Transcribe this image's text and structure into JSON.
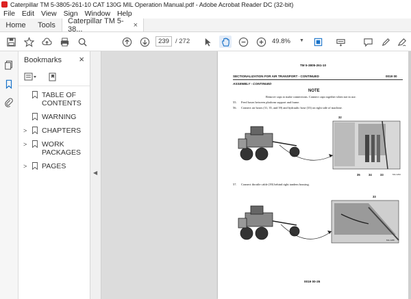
{
  "window": {
    "title": "Caterpillar TM 5-3805-261-10 CAT 130G MIL Operation Manual.pdf - Adobe Acrobat Reader DC (32-bit)"
  },
  "menu": {
    "items": [
      "File",
      "Edit",
      "View",
      "Sign",
      "Window",
      "Help"
    ]
  },
  "tabs": {
    "home": "Home",
    "tools": "Tools",
    "document": "Caterpillar TM 5-38...",
    "close": "×"
  },
  "toolbar": {
    "current_page": "239",
    "page_total": "/ 272",
    "zoom": "49.8%"
  },
  "bookmarks": {
    "header": "Bookmarks",
    "close": "×",
    "items": [
      {
        "label_line1": "TABLE OF",
        "label_line2": "CONTENTS",
        "expandable": false
      },
      {
        "label_line1": "WARNING",
        "label_line2": "",
        "expandable": false
      },
      {
        "label_line1": "CHAPTERS",
        "label_line2": "",
        "expandable": true
      },
      {
        "label_line1": "WORK",
        "label_line2": "PACKAGES",
        "expandable": true
      },
      {
        "label_line1": "PAGES",
        "label_line2": "",
        "expandable": true
      }
    ]
  },
  "pdf_page": {
    "doc_number": "TM 5-3805-261-10",
    "section_title": "SECTIONALIZATION FOR AIR TRANSPORT - CONTINUED",
    "section_code": "0019 00",
    "subsection": "ASSEMBLY - CONTINUED",
    "note_title": "NOTE",
    "note_text": "Remove caps to make connections. Connect caps together when not in use.",
    "steps": [
      {
        "num": "55.",
        "text": "Feed hoses between platform support and frame."
      },
      {
        "num": "56.",
        "text": "Connect air hoses (31, 35, and 39) and hydraulic hose (33) on right side of machine."
      },
      {
        "num": "57.",
        "text": "Connect throttle cable (39) behind right tandem housing."
      }
    ],
    "fig1_callouts": [
      "32",
      "35",
      "34",
      "33"
    ],
    "fig1_tag": "M1-1234",
    "fig2_callouts": [
      "33"
    ],
    "fig2_tag": "M1-1235",
    "footer": "0019 00-35"
  },
  "colors": {
    "accent": "#1a73c9",
    "app_red": "#d22222"
  }
}
